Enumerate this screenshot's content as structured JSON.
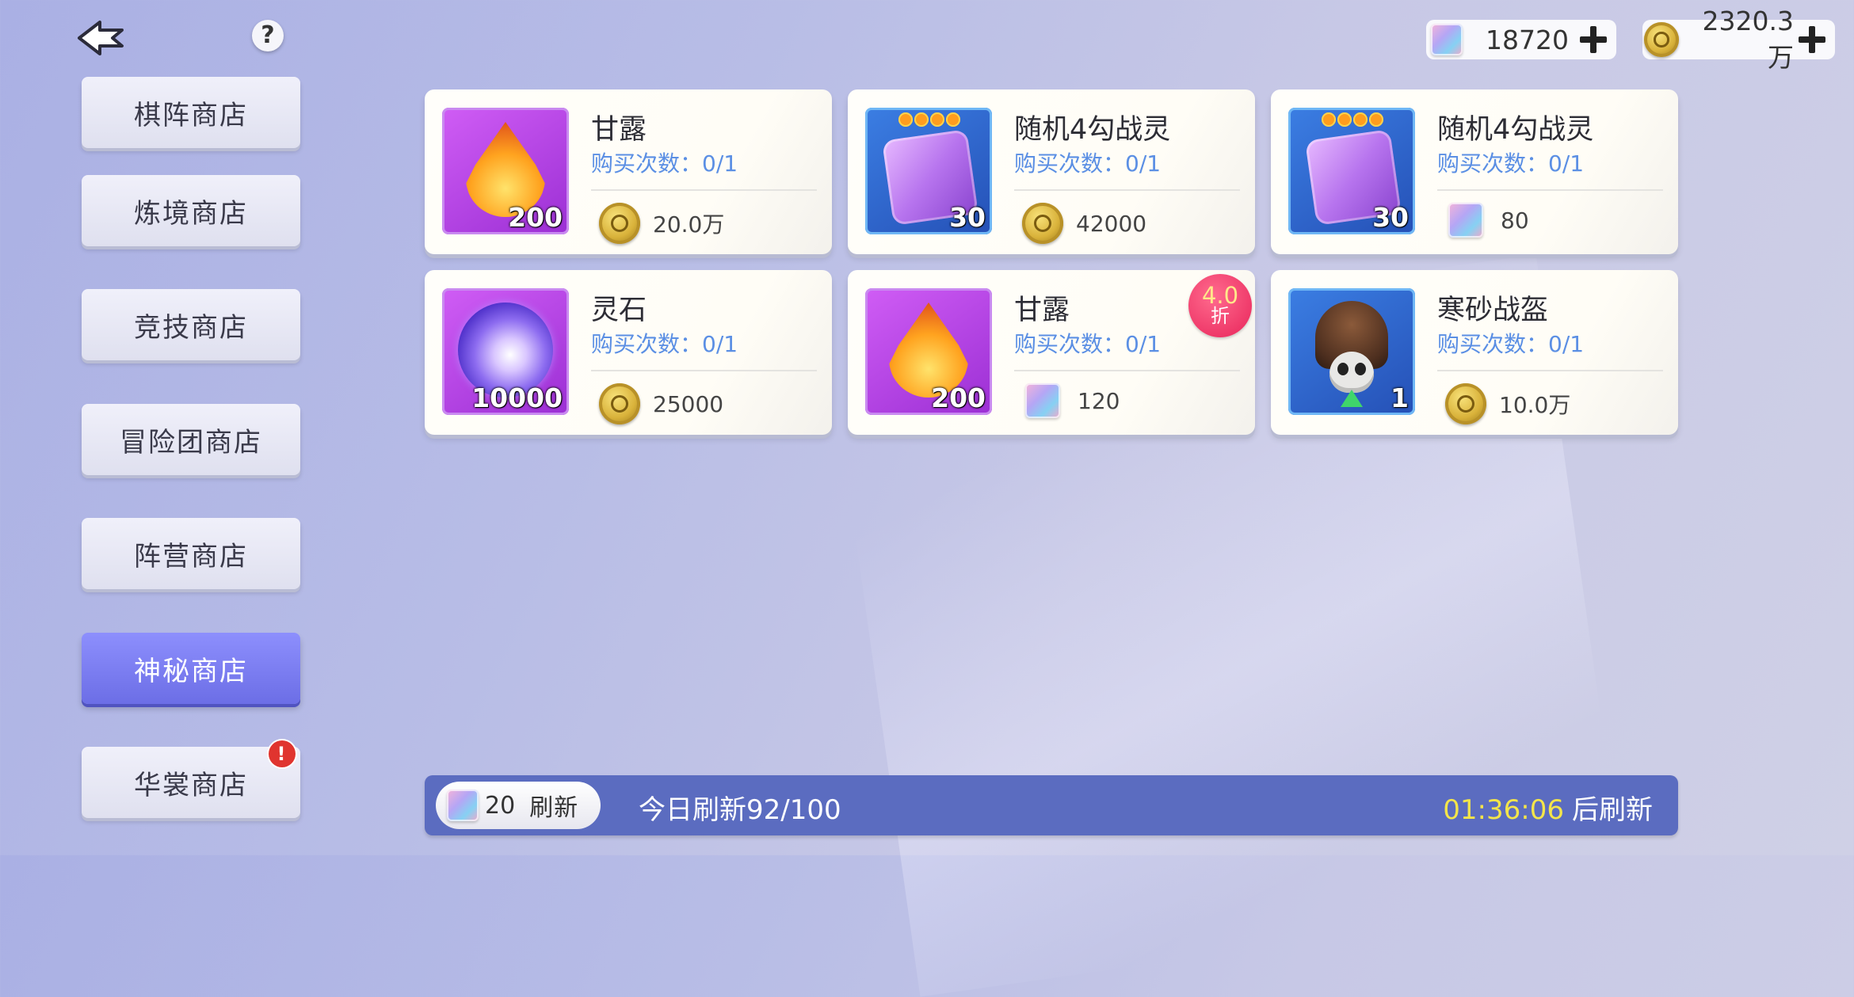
{
  "topbar": {
    "help": "?",
    "gems": "18720",
    "coins": "2320.3万"
  },
  "sidebar": {
    "items": [
      {
        "label": "棋阵商店"
      },
      {
        "label": "炼境商店"
      },
      {
        "label": "竞技商店"
      },
      {
        "label": "冒险团商店"
      },
      {
        "label": "阵营商店"
      },
      {
        "label": "神秘商店",
        "active": true
      },
      {
        "label": "华裳商店",
        "alert": "!"
      }
    ]
  },
  "shop": {
    "items": [
      {
        "name": "甘露",
        "limit": "购买次数：0/1",
        "qty": "200",
        "price": "20.0万",
        "currency": "coin",
        "icon": "nectar-drop-icon"
      },
      {
        "name": "随机4勾战灵",
        "limit": "购买次数：0/1",
        "qty": "30",
        "price": "42000",
        "currency": "coin",
        "icon": "puzzle-spirit-icon"
      },
      {
        "name": "随机4勾战灵",
        "limit": "购买次数：0/1",
        "qty": "30",
        "price": "80",
        "currency": "gem",
        "icon": "puzzle-spirit-icon"
      },
      {
        "name": "灵石",
        "limit": "购买次数：0/1",
        "qty": "10000",
        "price": "25000",
        "currency": "coin",
        "icon": "spirit-stone-orb-icon"
      },
      {
        "name": "甘露",
        "limit": "购买次数：0/1",
        "qty": "200",
        "price": "120",
        "currency": "gem",
        "icon": "nectar-drop-icon",
        "discount_value": "4.0",
        "discount_unit": "折"
      },
      {
        "name": "寒砂战盔",
        "limit": "购买次数：0/1",
        "qty": "1",
        "price": "10.0万",
        "currency": "coin",
        "icon": "war-helmet-icon"
      }
    ]
  },
  "bottom": {
    "refresh_cost": "20",
    "refresh_label": "刷新",
    "today": "今日刷新92/100",
    "countdown_time": "01:36:06",
    "countdown_suffix": "后刷新"
  },
  "colors": {
    "accent_active": "#7b7df5",
    "limit_text": "#5b8fe4",
    "bottom_bar": "#5b6cc0",
    "countdown": "#f4e54a",
    "discount": "#e8245a"
  }
}
